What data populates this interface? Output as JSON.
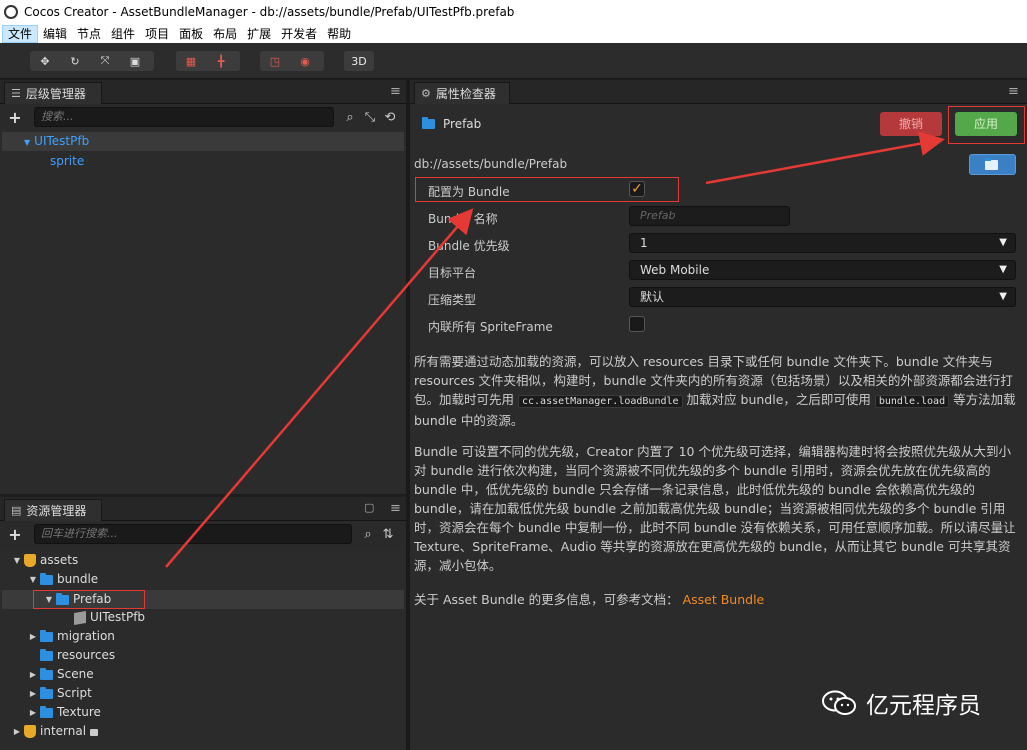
{
  "window": {
    "title": "Cocos Creator - AssetBundleManager - db://assets/bundle/Prefab/UITestPfb.prefab"
  },
  "menu": [
    "文件",
    "编辑",
    "节点",
    "组件",
    "项目",
    "面板",
    "布局",
    "扩展",
    "开发者",
    "帮助"
  ],
  "toolbar": {
    "mode_3d_label": "3D"
  },
  "hierarchy": {
    "tab_label": "层级管理器",
    "search_placeholder": "搜索...",
    "root_node": "UITestPfb",
    "child_node": "sprite"
  },
  "assets": {
    "tab_label": "资源管理器",
    "search_placeholder": "回车进行搜索...",
    "tree": [
      {
        "label": "assets"
      },
      {
        "label": "bundle"
      },
      {
        "label": "Prefab"
      },
      {
        "label": "UITestPfb"
      },
      {
        "label": "migration"
      },
      {
        "label": "resources"
      },
      {
        "label": "Scene"
      },
      {
        "label": "Script"
      },
      {
        "label": "Texture"
      },
      {
        "label": "internal"
      }
    ]
  },
  "inspector": {
    "tab_label": "属性检查器",
    "asset_name": "Prefab",
    "revert_label": "撤销",
    "apply_label": "应用",
    "path": "db://assets/bundle/Prefab",
    "props": {
      "is_bundle_label": "配置为 Bundle",
      "bundle_name_label": "Bundle 名称",
      "bundle_name_placeholder": "Prefab",
      "priority_label": "Bundle 优先级",
      "priority_value": "1",
      "platform_label": "目标平台",
      "platform_value": "Web Mobile",
      "compression_label": "压缩类型",
      "compression_value": "默认",
      "inline_label": "内联所有 SpriteFrame"
    },
    "desc1_a": "所有需要通过动态加载的资源，可以放入 resources 目录下或任何 bundle 文件夹下。bundle 文件夹与 resources 文件夹相似，构建时，bundle 文件夹内的所有资源（包括场景）以及相关的外部资源都会进行打包。加载时可先用",
    "desc1_code1": "cc.assetManager.loadBundle",
    "desc1_b": "加载对应 bundle，之后即可使用",
    "desc1_code2": "bundle.load",
    "desc1_c": "等方法加载 bundle 中的资源。",
    "desc2": "Bundle 可设置不同的优先级，Creator 内置了 10 个优先级可选择，编辑器构建时将会按照优先级从大到小对 bundle 进行依次构建，当同个资源被不同优先级的多个 bundle 引用时，资源会优先放在优先级高的 bundle 中，低优先级的 bundle 只会存储一条记录信息，此时低优先级的 bundle 会依赖高优先级的 bundle，请在加载低优先级 bundle 之前加载高优先级 bundle；当资源被相同优先级的多个 bundle 引用时，资源会在每个 bundle 中复制一份，此时不同 bundle 没有依赖关系，可用任意顺序加载。所以请尽量让 Texture、SpriteFrame、Audio 等共享的资源放在更高优先级的 bundle，从而让其它 bundle 可共享其资源，减小包体。",
    "more_info": "关于 Asset Bundle 的更多信息，可参考文档：",
    "more_link": "Asset Bundle"
  },
  "watermark": "亿元程序员",
  "colors": {
    "accent": "#3ea0ff",
    "annotation": "#e53935",
    "link": "#f08a24",
    "apply": "#4caf50",
    "revert": "#c0393b"
  }
}
